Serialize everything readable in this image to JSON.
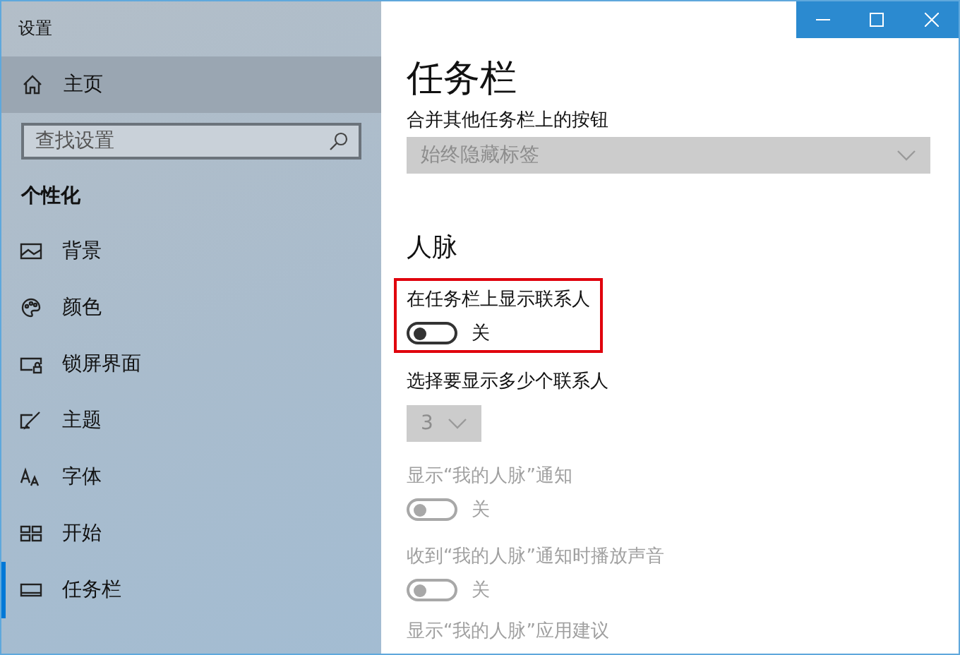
{
  "window": {
    "title": "设置"
  },
  "sidebar": {
    "home": {
      "label": "主页"
    },
    "search": {
      "placeholder": "查找设置"
    },
    "section": "个性化",
    "items": [
      {
        "label": "背景",
        "selected": false
      },
      {
        "label": "颜色",
        "selected": false
      },
      {
        "label": "锁屏界面",
        "selected": false
      },
      {
        "label": "主题",
        "selected": false
      },
      {
        "label": "字体",
        "selected": false
      },
      {
        "label": "开始",
        "selected": false
      },
      {
        "label": "任务栏",
        "selected": true
      }
    ]
  },
  "content": {
    "title": "任务栏",
    "settings": [
      {
        "kind": "select",
        "label": "合并其他任务栏上的按钮",
        "value": "始终隐藏标签",
        "disabled": true
      },
      {
        "kind": "heading",
        "label": "人脉"
      },
      {
        "kind": "toggle",
        "label": "在任务栏上显示联系人",
        "on": false,
        "state": "关",
        "disabled": false,
        "highlighted": true
      },
      {
        "kind": "number-select",
        "label": "选择要显示多少个联系人",
        "value": "3",
        "disabled": true
      },
      {
        "kind": "toggle",
        "label": "显示“我的人脉”通知",
        "on": false,
        "state": "关",
        "disabled": true
      },
      {
        "kind": "toggle",
        "label": "收到“我的人脉”通知时播放声音",
        "on": false,
        "state": "关",
        "disabled": true
      },
      {
        "kind": "label",
        "label": "显示“我的人脉”应用建议",
        "disabled": true
      }
    ]
  }
}
